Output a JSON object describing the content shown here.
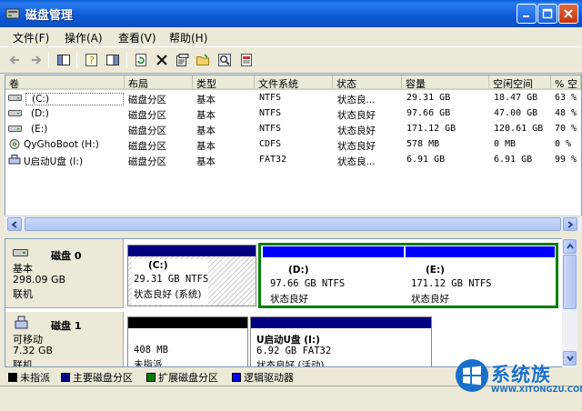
{
  "window": {
    "title": "磁盘管理"
  },
  "menu": [
    "文件(F)",
    "操作(A)",
    "查看(V)",
    "帮助(H)"
  ],
  "table": {
    "columns": [
      "卷",
      "布局",
      "类型",
      "文件系统",
      "状态",
      "容量",
      "空闲空间",
      "% 空"
    ],
    "rows": [
      [
        "(C:)",
        "磁盘分区",
        "基本",
        "NTFS",
        "状态良...",
        "29.31 GB",
        "18.47 GB",
        "63 %"
      ],
      [
        "(D:)",
        "磁盘分区",
        "基本",
        "NTFS",
        "状态良好",
        "97.66 GB",
        "47.00 GB",
        "48 %"
      ],
      [
        "(E:)",
        "磁盘分区",
        "基本",
        "NTFS",
        "状态良好",
        "171.12 GB",
        "120.61 GB",
        "70 %"
      ],
      [
        "QyGhoBoot (H:)",
        "磁盘分区",
        "基本",
        "CDFS",
        "状态良好",
        "578 MB",
        "0 MB",
        "0 %"
      ],
      [
        "U启动U盘 (I:)",
        "磁盘分区",
        "基本",
        "FAT32",
        "状态良...",
        "6.91 GB",
        "6.91 GB",
        "99 %"
      ]
    ]
  },
  "disks": [
    {
      "name": "磁盘 0",
      "type": "基本",
      "size": "298.09 GB",
      "state": "联机",
      "partitions": [
        {
          "label": "(C:)",
          "detail": "29.31 GB NTFS",
          "status": "状态良好 (系统)"
        },
        {
          "label": "(D:)",
          "detail": "97.66 GB NTFS",
          "status": "状态良好"
        },
        {
          "label": "(E:)",
          "detail": "171.12 GB NTFS",
          "status": "状态良好"
        }
      ]
    },
    {
      "name": "磁盘 1",
      "type": "可移动",
      "size": "7.32 GB",
      "state": "联机",
      "partitions": [
        {
          "label": "",
          "detail": "408 MB",
          "status": "未指派"
        },
        {
          "label": "U启动U盘 (I:)",
          "detail": "6.92 GB FAT32",
          "status": "状态良好 (活动)"
        }
      ]
    }
  ],
  "legend": [
    {
      "label": "未指派",
      "color": "#000000"
    },
    {
      "label": "主要磁盘分区",
      "color": "#000080"
    },
    {
      "label": "扩展磁盘分区",
      "color": "#008000"
    },
    {
      "label": "逻辑驱动器",
      "color": "#0000ff"
    }
  ],
  "watermark": {
    "brand": "系统族",
    "url": "WWW.XITONGZU.COM"
  },
  "colors": {
    "titlebar": "#0a5fd8",
    "primary": "#000080",
    "logical": "#0000ff",
    "extended": "#008000",
    "unallocated": "#000000"
  }
}
